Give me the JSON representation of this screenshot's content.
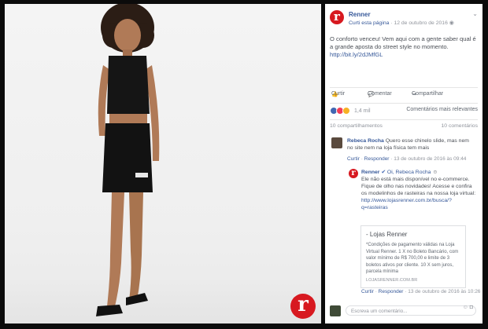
{
  "post": {
    "page_name": "Renner",
    "follow_link": "Curti esta página",
    "date": "12 de outubro de 2016",
    "text": "O conforto venceu! Vem aqui com a gente saber qual é a grande aposta do street style no momento.",
    "url": "http://bit.ly/2dJMfGL"
  },
  "actions": {
    "like": "Curtir",
    "comment": "Comentar",
    "share": "Compartilhar"
  },
  "reactions": {
    "count": "1,4 mil",
    "sort": "Comentários mais relevantes"
  },
  "stats": {
    "shares": "10 compartilhamentos",
    "comments": "10 comentários"
  },
  "comment1": {
    "author": "Rebeca Rocha",
    "text": "Quero esse chinelo slide, mas nem no site nem na loja física tem mais",
    "like": "Curtir",
    "reply": "Responder",
    "date": "13 de outubro de 2016 às 09:44"
  },
  "reply": {
    "author": "Renner",
    "mention": "Oi, Rebeca Rocha",
    "text": "Ele não está mais disponível no e-commerce. Fique de olho nas novidades! Acesse e confira os modelinhos de rasteiras na nossa loja virtual:",
    "link": "http://www.lojasrenner.com.br/busca/?q=rasteiras",
    "card_title": "- Lojas Renner",
    "card_body": "*Condições de pagamento válidas na Loja Virtual Renner. 1 X no Boleto Bancário, com valor mínimo de R$ 700,00 e limite de 3 boletos ativos por cliente. 10 X sem juros, parcela mínima",
    "card_domain": "LOJASRENNER.COM.BR",
    "like": "Curtir",
    "respond": "Responder",
    "date": "13 de outubro de 2016 às 10:26"
  },
  "write": {
    "placeholder": "Escreva um comentário..."
  },
  "photo": {
    "badge": "r"
  }
}
